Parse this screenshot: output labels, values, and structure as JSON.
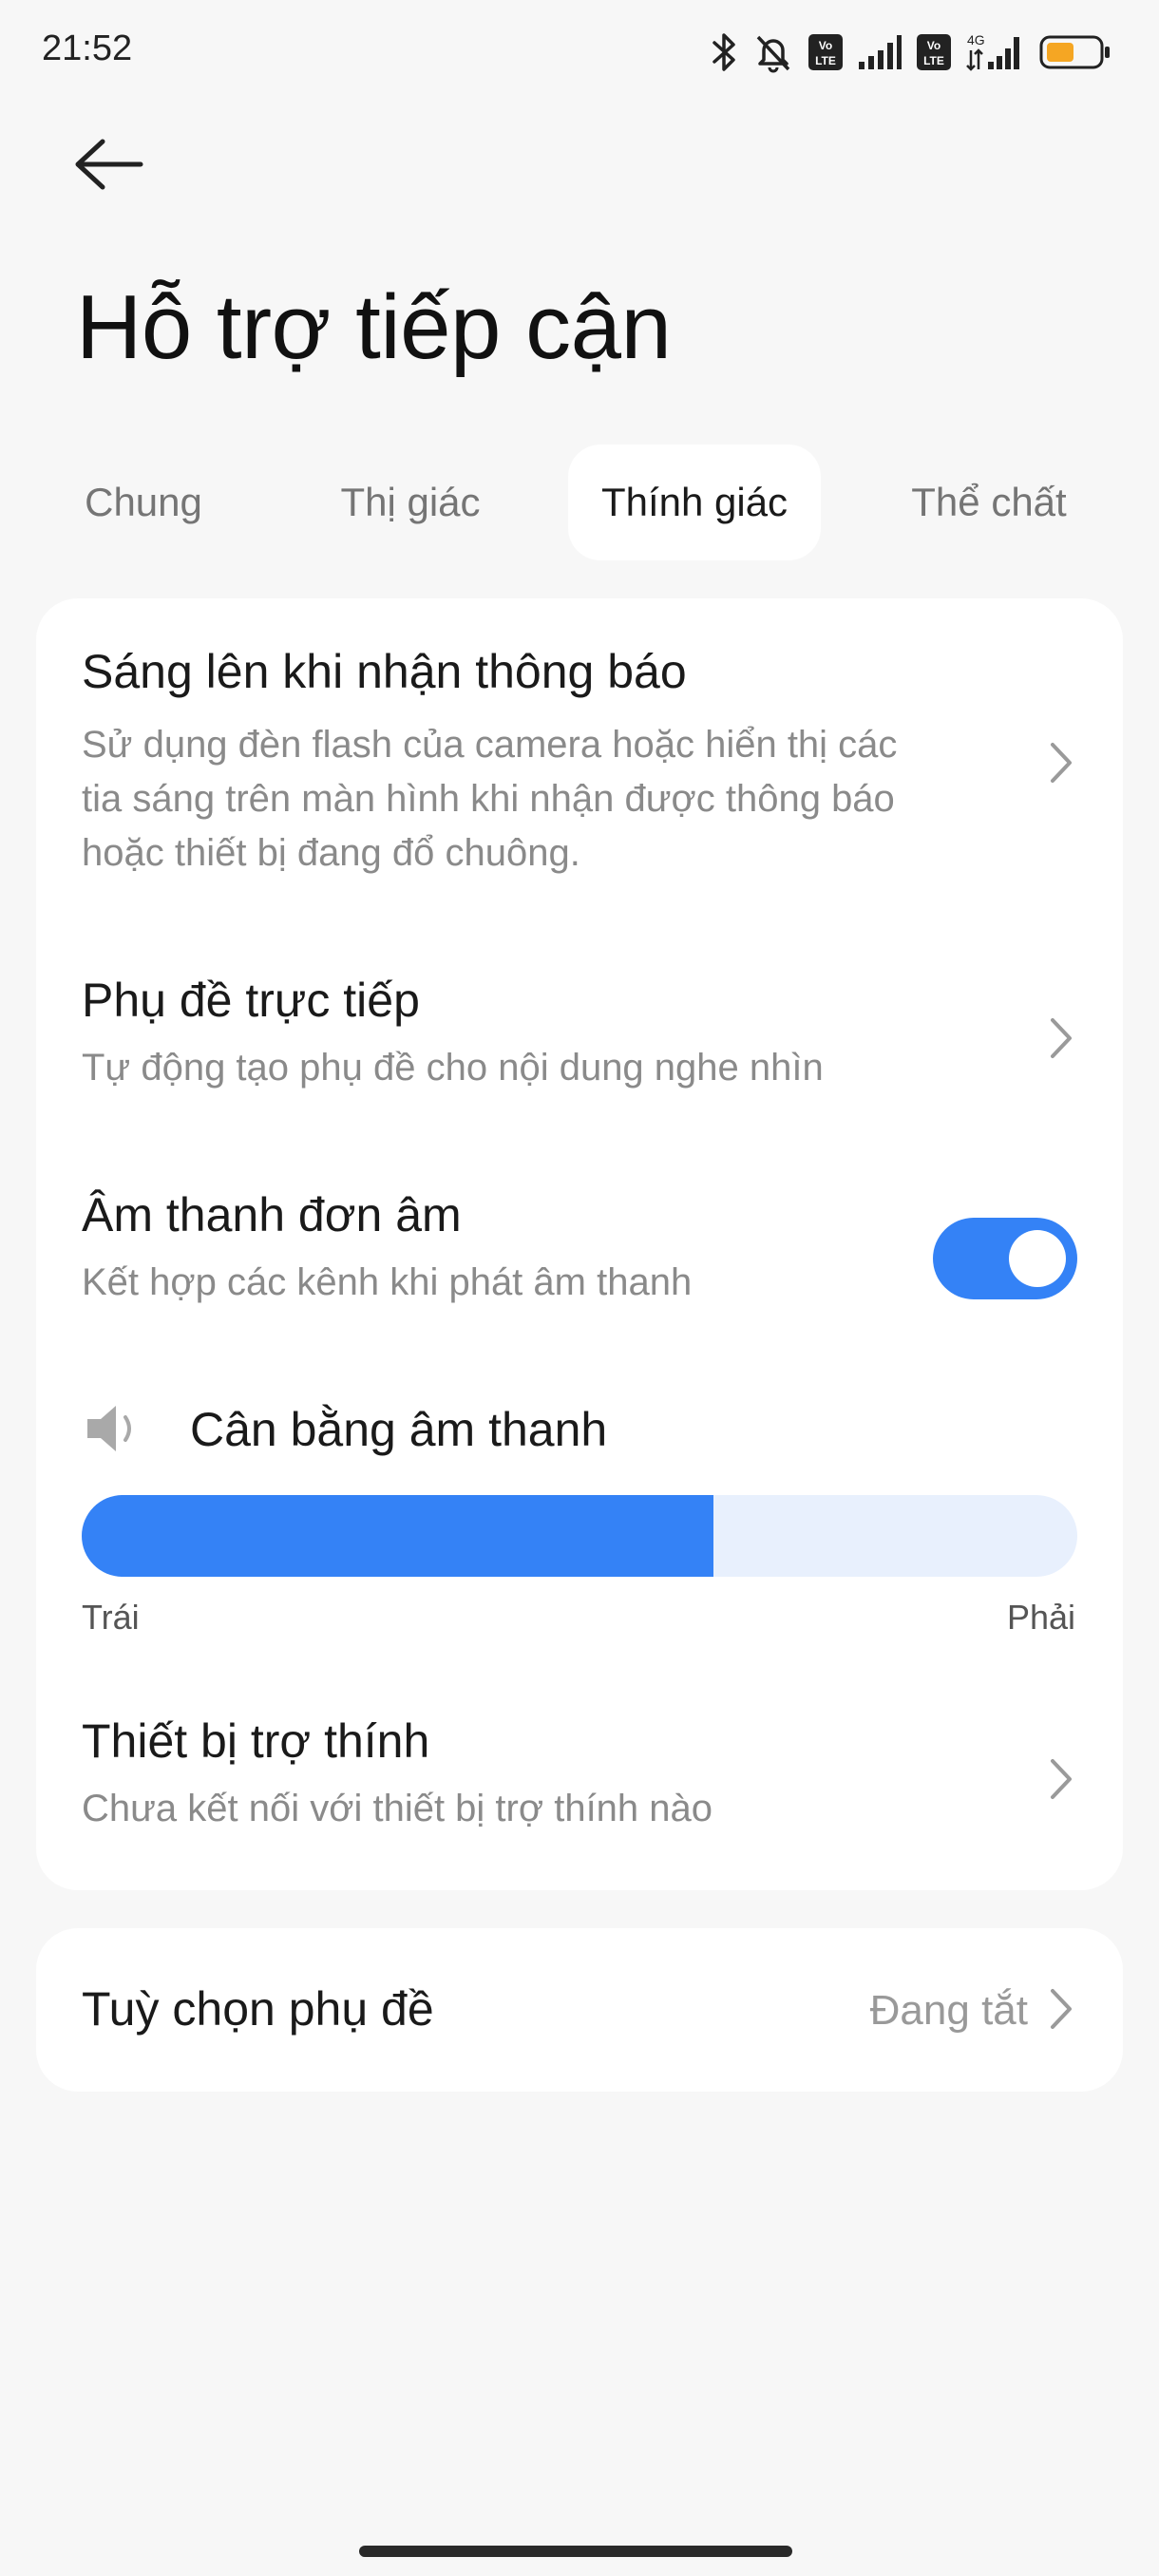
{
  "status": {
    "time": "21:52",
    "network": "4G",
    "volte_1": "Vo LTE",
    "volte_2": "Vo LTE",
    "battery_color": "#f5a623"
  },
  "header": {
    "title": "Hỗ trợ tiếp cận"
  },
  "tabs": [
    {
      "label": "Chung",
      "active": false
    },
    {
      "label": "Thị giác",
      "active": false
    },
    {
      "label": "Thính giác",
      "active": true
    },
    {
      "label": "Thể chất",
      "active": false
    }
  ],
  "settings": {
    "flash_notifications": {
      "title": "Sáng lên khi nhận thông báo",
      "subtitle": "Sử dụng đèn flash của camera hoặc hiển thị các tia sáng trên màn hình khi nhận được thông báo hoặc thiết bị đang đổ chuông."
    },
    "live_caption": {
      "title": "Phụ đề trực tiếp",
      "subtitle": "Tự động tạo phụ đề cho nội dung nghe nhìn"
    },
    "mono_audio": {
      "title": "Âm thanh đơn âm",
      "subtitle": "Kết hợp các kênh khi phát âm thanh",
      "enabled": true
    },
    "audio_balance": {
      "title": "Cân bằng âm thanh",
      "left_label": "Trái",
      "right_label": "Phải",
      "value": 0.635
    },
    "hearing_aids": {
      "title": "Thiết bị trợ thính",
      "subtitle": "Chưa kết nối với thiết bị trợ thính nào"
    }
  },
  "caption_options": {
    "title": "Tuỳ chọn phụ đề",
    "value": "Đang tắt"
  },
  "colors": {
    "accent": "#3482f6",
    "track": "#e8f0fd",
    "background": "#f7f7f7",
    "card": "#ffffff"
  }
}
